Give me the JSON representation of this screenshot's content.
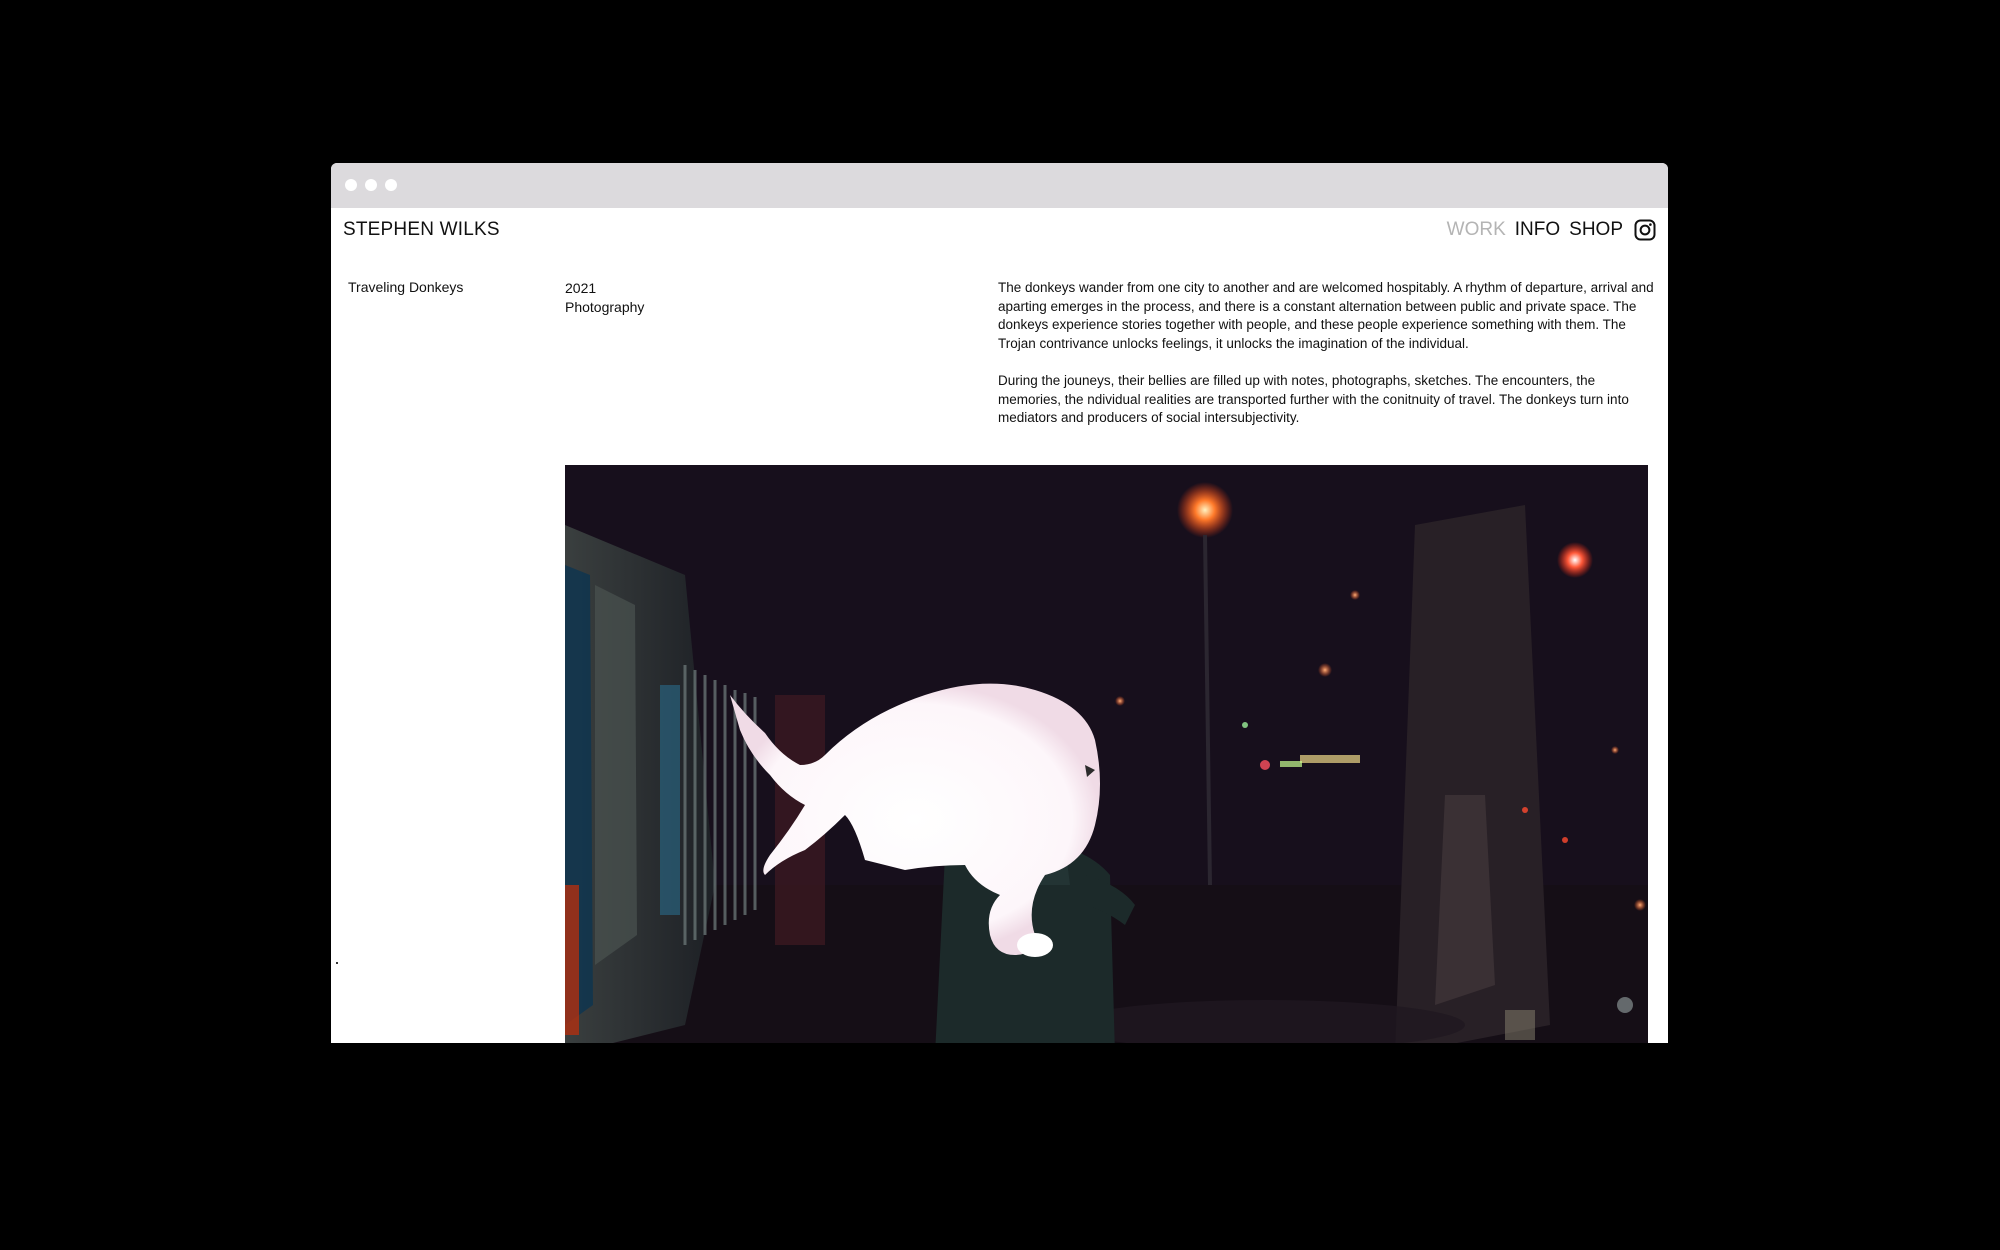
{
  "window": {
    "title_bar_color": "#dcdadd"
  },
  "header": {
    "logo": "STEPHEN WILKS",
    "nav": [
      {
        "label": "WORK",
        "active": true
      },
      {
        "label": "INFO",
        "active": false
      },
      {
        "label": "SHOP",
        "active": false
      }
    ],
    "social_icon": "instagram-icon"
  },
  "project": {
    "title": "Traveling Donkeys",
    "year": "2021",
    "category": "Photography",
    "description": [
      "The donkeys wander from one city to another and are welcomed hospitably. A rhythm of departure, arrival and aparting emerges in the process, and there is a constant alternation between public and private space. The donkeys experience stories together with people, and these people experience something with them. The Trojan contrivance unlocks feelings, it unlocks the imagination of the individual.",
      "During the jouneys, their bellies are filled up with notes, photographs, sketches. The encounters, the memories, the ndividual realities are transported further with the conitnuity of travel. The donkeys turn into mediators and producers of social intersubjectivity."
    ]
  },
  "colors": {
    "background": "#000000",
    "page": "#ffffff",
    "text": "#111111",
    "nav_active": "#b4b4b4"
  }
}
